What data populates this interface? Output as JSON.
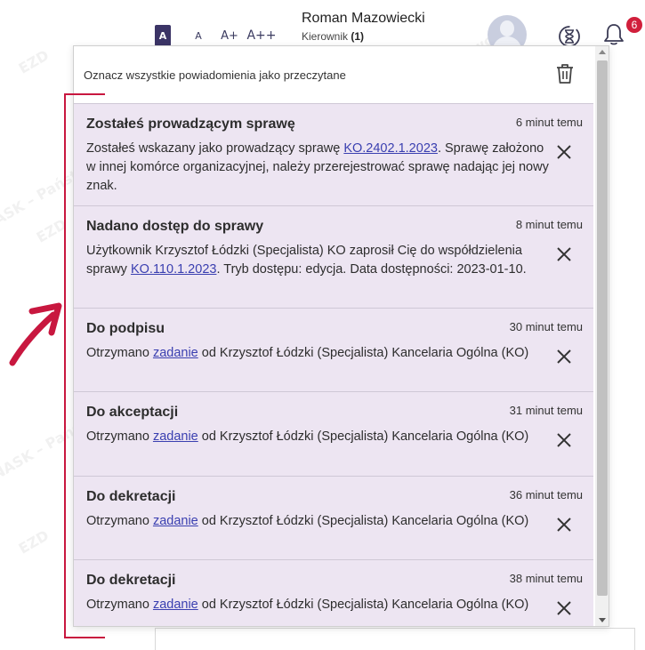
{
  "header": {
    "font_sizes": [
      "A",
      "A",
      "A+",
      "A++"
    ],
    "user_name": "Roman Mazowiecki",
    "user_role": "Kierownik",
    "user_role_count": "(1)",
    "notification_count": "6"
  },
  "panel": {
    "mark_all_read": "Oznacz wszystkie powiadomienia jako przeczytane",
    "notifications": [
      {
        "title": "Zostałeś prowadzącym sprawę",
        "time": "6 minut temu",
        "text_before": "Zostałeś wskazany jako prowadzący sprawę ",
        "link": "KO.2402.1.2023",
        "text_after": ". Sprawę założono w innej komórce organizacyjnej, należy przerejestrować sprawę nadając jej nowy znak."
      },
      {
        "title": "Nadano dostęp do sprawy",
        "time": "8 minut temu",
        "text_before": "Użytkownik Krzysztof Łódzki (Specjalista) KO zaprosił Cię do współdzielenia sprawy ",
        "link": "KO.110.1.2023",
        "text_after": ". Tryb dostępu: edycja. Data dostępności: 2023-01-10."
      },
      {
        "title": "Do podpisu",
        "time": "30 minut temu",
        "text_before": "Otrzymano ",
        "link": "zadanie",
        "text_after": " od Krzysztof Łódzki (Specjalista) Kancelaria Ogólna (KO)"
      },
      {
        "title": "Do akceptacji",
        "time": "31 minut temu",
        "text_before": "Otrzymano ",
        "link": "zadanie",
        "text_after": " od Krzysztof Łódzki (Specjalista) Kancelaria Ogólna (KO)"
      },
      {
        "title": "Do dekretacji",
        "time": "36 minut temu",
        "text_before": "Otrzymano ",
        "link": "zadanie",
        "text_after": " od Krzysztof Łódzki (Specjalista) Kancelaria Ogólna (KO)"
      },
      {
        "title": "Do dekretacji",
        "time": "38 minut temu",
        "text_before": "Otrzymano ",
        "link": "zadanie",
        "text_after": " od Krzysztof Łódzki (Specjalista) Kancelaria Ogólna (KO)"
      }
    ]
  },
  "watermark": {
    "brand": "EZD",
    "institute": "NASK – Państwowy Instytut Badawczy"
  },
  "colors": {
    "accent": "#3b3466",
    "badge": "#d11f3b",
    "annotation": "#c8173f",
    "item_bg": "#ede5f2",
    "link": "#3a3fb0"
  }
}
